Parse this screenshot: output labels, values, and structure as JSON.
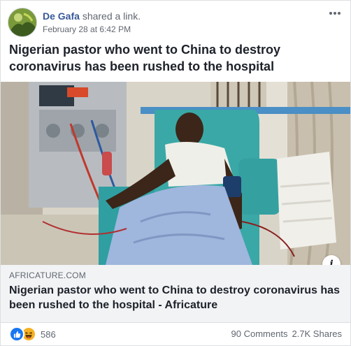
{
  "post": {
    "author": "De Gafa",
    "action": "shared a link.",
    "timestamp": "February 28 at 6:42 PM",
    "text": "Nigerian pastor who went to China to destroy coronavirus has been rushed to the hospital",
    "more_icon": "ellipsis-horizontal-icon"
  },
  "link": {
    "domain": "AFRICATURE.COM",
    "title": "Nigerian pastor who went to China to destroy coronavirus has been rushed to the hospital - Africature",
    "info_label": "i",
    "image_description_icon": "dialysis-photo"
  },
  "footer": {
    "reaction_icons": [
      "like-icon",
      "haha-icon"
    ],
    "reaction_count": "586",
    "comments": "90 Comments",
    "shares": "2.7K Shares"
  },
  "colors": {
    "author_blue": "#385898",
    "like_blue": "#1877f2",
    "haha_yellow": "#f7b125",
    "meta_bg": "#f2f3f5"
  }
}
